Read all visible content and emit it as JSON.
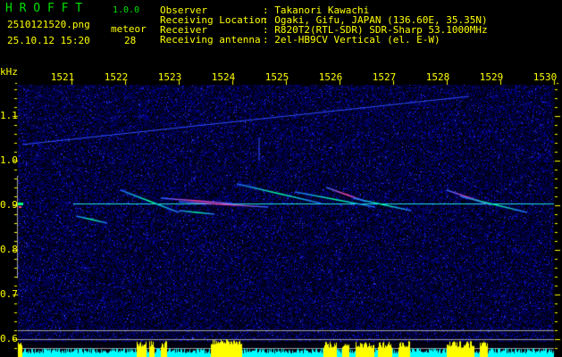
{
  "app": {
    "name": "H R O F F T",
    "version": "1.0.0"
  },
  "file": {
    "name": "2510121520.png",
    "datetime": "25.10.12 15:20"
  },
  "meteor": {
    "label": "meteor",
    "count": "28"
  },
  "info": [
    {
      "label": "Observer",
      "value": ": Takanori Kawachi"
    },
    {
      "label": "Receiving Location",
      "value": ": Ogaki, Gifu, JAPAN (136.60E, 35.35N)"
    },
    {
      "label": "Receiver",
      "value": ": R820T2(RTL-SDR) SDR-Sharp 53.1000MHz"
    },
    {
      "label": "Receiving antenna",
      "value": ": 2el-HB9CV Vertical (el. E-W)"
    }
  ],
  "axes": {
    "unit": "kHz",
    "x_ticks": [
      "1521",
      "1522",
      "1523",
      "1524",
      "1525",
      "1526",
      "1527",
      "1528",
      "1529",
      "1530"
    ],
    "y_ticks": [
      "1.1",
      "1.0",
      "0.9",
      "0.8",
      "0.7",
      "0.6"
    ]
  },
  "colors": {
    "background": "#000000",
    "text": "#ffff00",
    "logo": "#00e000",
    "noise": "#0000a0",
    "histogram_low": "#00ffff",
    "histogram_high": "#ffff00"
  }
}
